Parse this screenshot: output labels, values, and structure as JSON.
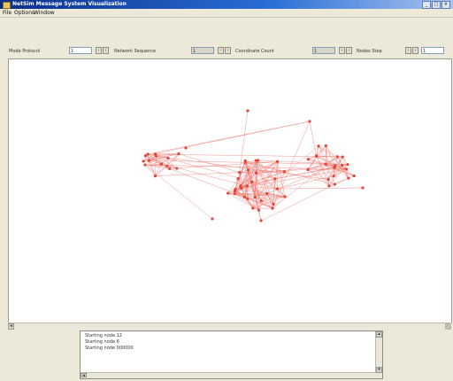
{
  "window": {
    "title": "NetSim Message System Visualization",
    "controls": [
      "_",
      "□",
      "×"
    ]
  },
  "menu": {
    "items": [
      "File",
      "Options",
      "Window"
    ]
  },
  "toolbar": {
    "mode_label": "Mode Protocol",
    "mode_value": "1",
    "network_label": "Network Sequence",
    "network_value": "1",
    "coord_label": "Coordinate Count",
    "coord_value": "1",
    "step_label": "Nodes Step",
    "step_value": "1"
  },
  "graph": {
    "node_color": "#e0463a",
    "edge_color": "#ee7a72",
    "cluster_count": 3
  },
  "log": {
    "lines": [
      "Starting node 12",
      "Starting node 6",
      "Starting node 000000"
    ]
  }
}
